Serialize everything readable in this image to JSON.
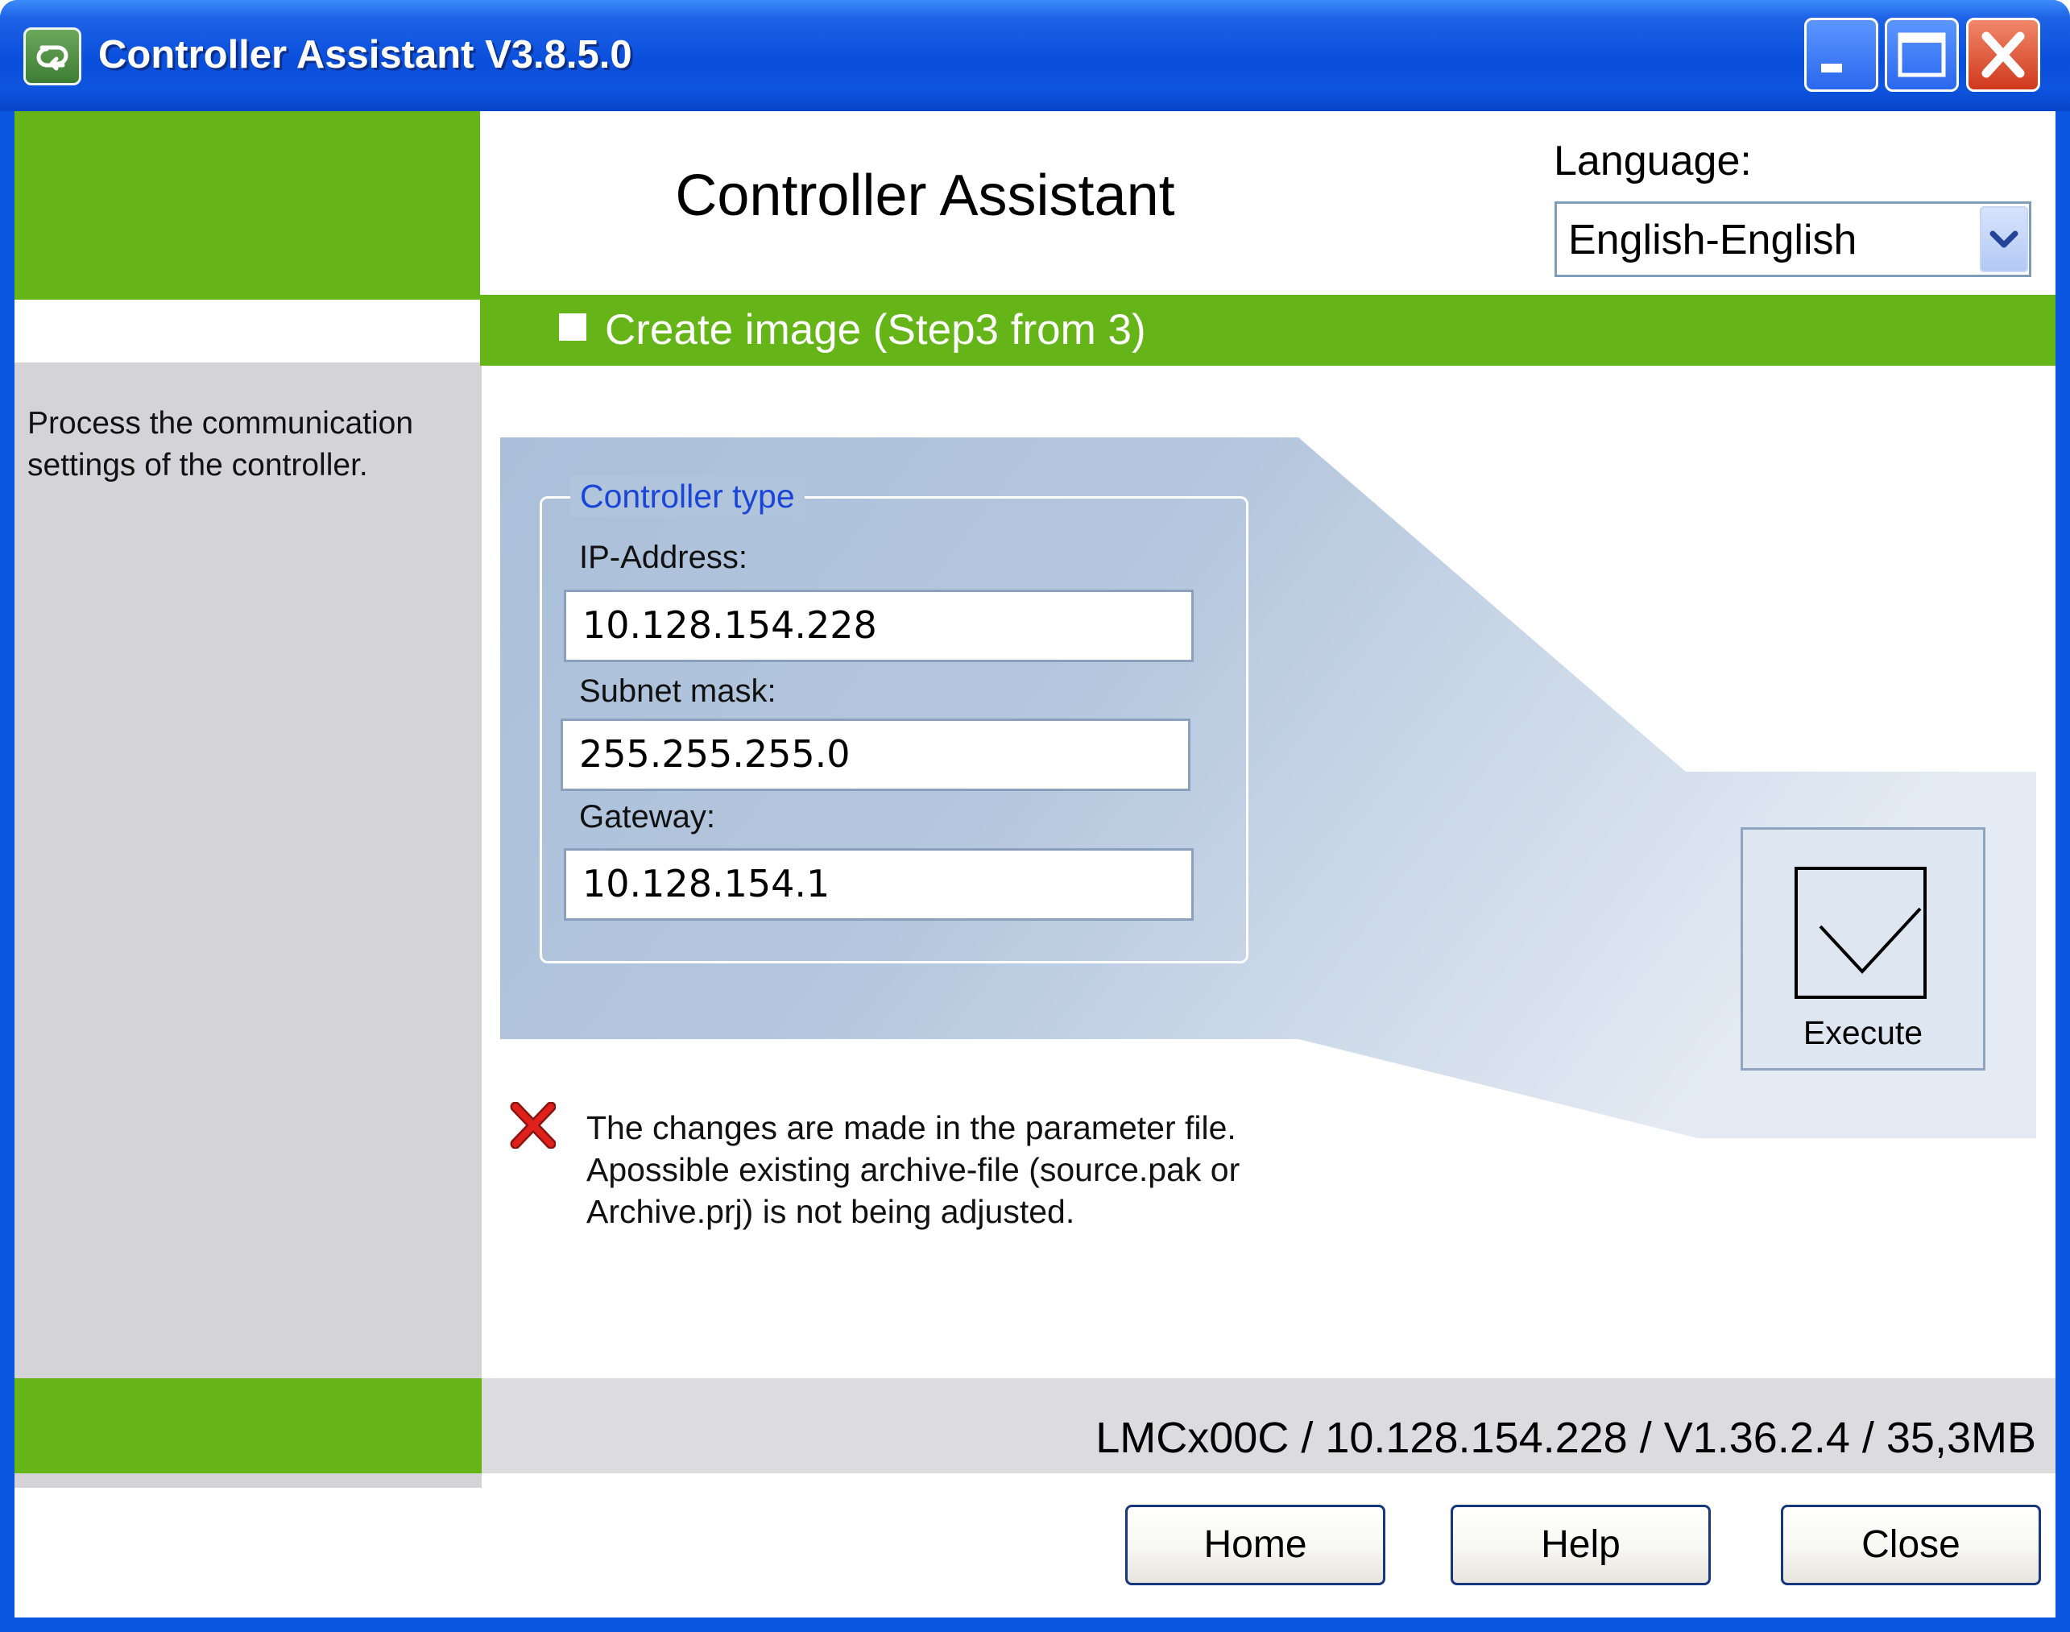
{
  "window": {
    "title": "Controller Assistant V3.8.5.0",
    "app_icon": "app-icon",
    "controls": [
      "minimize-icon",
      "maximize-icon",
      "close-icon"
    ]
  },
  "header": {
    "heading": "Controller Assistant",
    "language_label": "Language:",
    "language_value": "English-English"
  },
  "step": {
    "label": "Create image (Step3 from 3)"
  },
  "sidebar": {
    "description": "Process the communication settings of the controller."
  },
  "form": {
    "legend": "Controller type",
    "ip_label": "IP-Address:",
    "ip_value": "10.128.154.228",
    "subnet_label": "Subnet mask:",
    "subnet_value": "255.255.255.0",
    "gateway_label": "Gateway:",
    "gateway_value": "10.128.154.1"
  },
  "execute": {
    "label": "Execute",
    "icon": "checkmark-icon"
  },
  "note": {
    "icon": "red-x-icon",
    "line1": "The changes are made in the parameter file.",
    "line2": "Apossible existing archive-file (source.pak or",
    "line3": "Archive.prj) is not being adjusted."
  },
  "status": {
    "text": "LMCx00C / 10.128.154.228 / V1.36.2.4 / 35,3MB"
  },
  "buttons": {
    "home": "Home",
    "help": "Help",
    "close": "Close"
  },
  "colors": {
    "titlebar_blue": "#0a4fdc",
    "accent_green": "#65b519",
    "panel_grey": "#d4d3d7",
    "form_blue": "#acc0d9",
    "legend_blue": "#1a45d6",
    "error_red": "#e0201b"
  }
}
